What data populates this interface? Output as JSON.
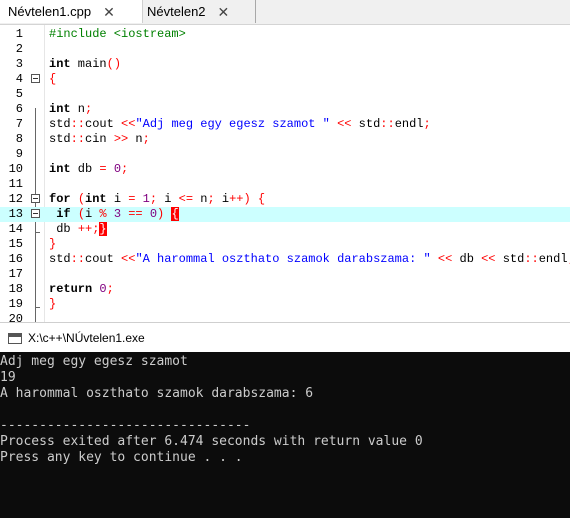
{
  "tabs": [
    {
      "label": "Névtelen1.cpp",
      "active": true
    },
    {
      "label": "Névtelen2",
      "active": false
    }
  ],
  "editor": {
    "line_numbers": [
      "1",
      "2",
      "3",
      "4",
      "5",
      "6",
      "7",
      "8",
      "9",
      "10",
      "11",
      "12",
      "13",
      "14",
      "15",
      "16",
      "17",
      "18",
      "19",
      "20"
    ],
    "lines": [
      "#include <iostream>",
      "",
      "int main()",
      "{",
      "",
      "int n;",
      "std::cout <<\"Adj meg egy egesz szamot \" << std::endl;",
      "std::cin >> n;",
      "",
      "int db = 0;",
      "",
      "for (int i = 1; i <= n; i++) {",
      " if (i % 3 == 0) {",
      " db ++;}",
      "}",
      "std::cout <<\"A harommal oszthato szamok darabszama: \" << db << std::endl;",
      "",
      "return 0;",
      "}",
      ""
    ],
    "highlighted_line": 13
  },
  "console": {
    "title": "X:\\c++\\NÚvtelen1.exe",
    "lines": [
      "Adj meg egy egesz szamot",
      "19",
      "A harommal oszthato szamok darabszama: 6",
      "",
      "--------------------------------",
      "Process exited after 6.474 seconds with return value 0",
      "Press any key to continue . . ."
    ]
  },
  "colors": {
    "keyword": "#000000",
    "preprocessor": "#008000",
    "string": "#0000ff",
    "number": "#800080",
    "symbol": "#ff0000",
    "highlight_line": "#ccffff",
    "console_bg": "#0c0c0c",
    "console_fg": "#cccccc"
  }
}
